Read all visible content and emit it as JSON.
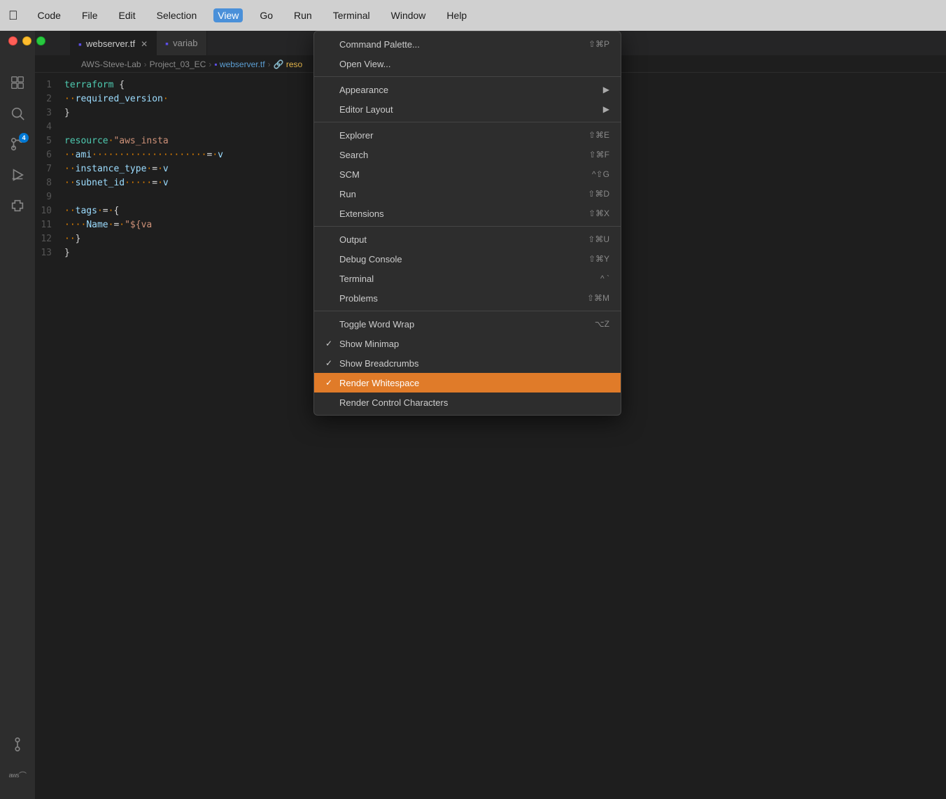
{
  "menubar": {
    "apple": "🍎",
    "items": [
      {
        "label": "Code",
        "active": false
      },
      {
        "label": "File",
        "active": false
      },
      {
        "label": "Edit",
        "active": false
      },
      {
        "label": "Selection",
        "active": false
      },
      {
        "label": "View",
        "active": true
      },
      {
        "label": "Go",
        "active": false
      },
      {
        "label": "Run",
        "active": false
      },
      {
        "label": "Terminal",
        "active": false
      },
      {
        "label": "Window",
        "active": false
      },
      {
        "label": "Help",
        "active": false
      }
    ]
  },
  "tabs": [
    {
      "label": "webserver.tf",
      "active": true,
      "icon": "terraform"
    },
    {
      "label": "variab",
      "active": false,
      "icon": "terraform"
    }
  ],
  "breadcrumb": {
    "parts": [
      "AWS-Steve-Lab",
      "Project_03_EC",
      "webserver.tf",
      "reso"
    ]
  },
  "code_lines": [
    {
      "num": "1",
      "content": "terraform {"
    },
    {
      "num": "2",
      "content": "··required_version·"
    },
    {
      "num": "3",
      "content": "}"
    },
    {
      "num": "4",
      "content": ""
    },
    {
      "num": "5",
      "content": "resource·\"aws_insta"
    },
    {
      "num": "6",
      "content": "··ami·····················=·v"
    },
    {
      "num": "7",
      "content": "··instance_type·=·v"
    },
    {
      "num": "8",
      "content": "··subnet_id·····=·v"
    },
    {
      "num": "9",
      "content": ""
    },
    {
      "num": "10",
      "content": "··tags·=·{"
    },
    {
      "num": "11",
      "content": "····Name·=·\"${va"
    },
    {
      "num": "12",
      "content": "··}"
    },
    {
      "num": "13",
      "content": "}"
    }
  ],
  "view_menu": {
    "items": [
      {
        "type": "item",
        "label": "Command Palette...",
        "shortcut": "⇧⌘P",
        "check": "",
        "arrow": false
      },
      {
        "type": "item",
        "label": "Open View...",
        "shortcut": "",
        "check": "",
        "arrow": false
      },
      {
        "type": "separator"
      },
      {
        "type": "item",
        "label": "Appearance",
        "shortcut": "",
        "check": "",
        "arrow": true
      },
      {
        "type": "item",
        "label": "Editor Layout",
        "shortcut": "",
        "check": "",
        "arrow": true
      },
      {
        "type": "separator"
      },
      {
        "type": "item",
        "label": "Explorer",
        "shortcut": "⇧⌘E",
        "check": "",
        "arrow": false
      },
      {
        "type": "item",
        "label": "Search",
        "shortcut": "⇧⌘F",
        "check": "",
        "arrow": false
      },
      {
        "type": "item",
        "label": "SCM",
        "shortcut": "^⇧G",
        "check": "",
        "arrow": false
      },
      {
        "type": "item",
        "label": "Run",
        "shortcut": "⇧⌘D",
        "check": "",
        "arrow": false
      },
      {
        "type": "item",
        "label": "Extensions",
        "shortcut": "⇧⌘X",
        "check": "",
        "arrow": false
      },
      {
        "type": "separator"
      },
      {
        "type": "item",
        "label": "Output",
        "shortcut": "⇧⌘U",
        "check": "",
        "arrow": false
      },
      {
        "type": "item",
        "label": "Debug Console",
        "shortcut": "⇧⌘Y",
        "check": "",
        "arrow": false
      },
      {
        "type": "item",
        "label": "Terminal",
        "shortcut": "^ `",
        "check": "",
        "arrow": false
      },
      {
        "type": "item",
        "label": "Problems",
        "shortcut": "⇧⌘M",
        "check": "",
        "arrow": false
      },
      {
        "type": "separator"
      },
      {
        "type": "item",
        "label": "Toggle Word Wrap",
        "shortcut": "⌥Z",
        "check": "",
        "arrow": false
      },
      {
        "type": "item",
        "label": "Show Minimap",
        "shortcut": "",
        "check": "✓",
        "arrow": false
      },
      {
        "type": "item",
        "label": "Show Breadcrumbs",
        "shortcut": "",
        "check": "✓",
        "arrow": false
      },
      {
        "type": "item",
        "label": "Render Whitespace",
        "shortcut": "",
        "check": "✓",
        "arrow": false,
        "highlighted": true
      },
      {
        "type": "item",
        "label": "Render Control Characters",
        "shortcut": "",
        "check": "",
        "arrow": false
      }
    ]
  },
  "activity": {
    "icons": [
      {
        "name": "files",
        "symbol": "⎘",
        "badge": null
      },
      {
        "name": "search",
        "symbol": "🔍",
        "badge": null
      },
      {
        "name": "scm",
        "symbol": "⑂",
        "badge": "4"
      },
      {
        "name": "run",
        "symbol": "▷",
        "badge": null
      },
      {
        "name": "extensions",
        "symbol": "⊞",
        "badge": null
      }
    ],
    "bottom": [
      {
        "name": "source-control",
        "symbol": "⑂"
      },
      {
        "name": "aws",
        "symbol": "aws"
      }
    ]
  }
}
